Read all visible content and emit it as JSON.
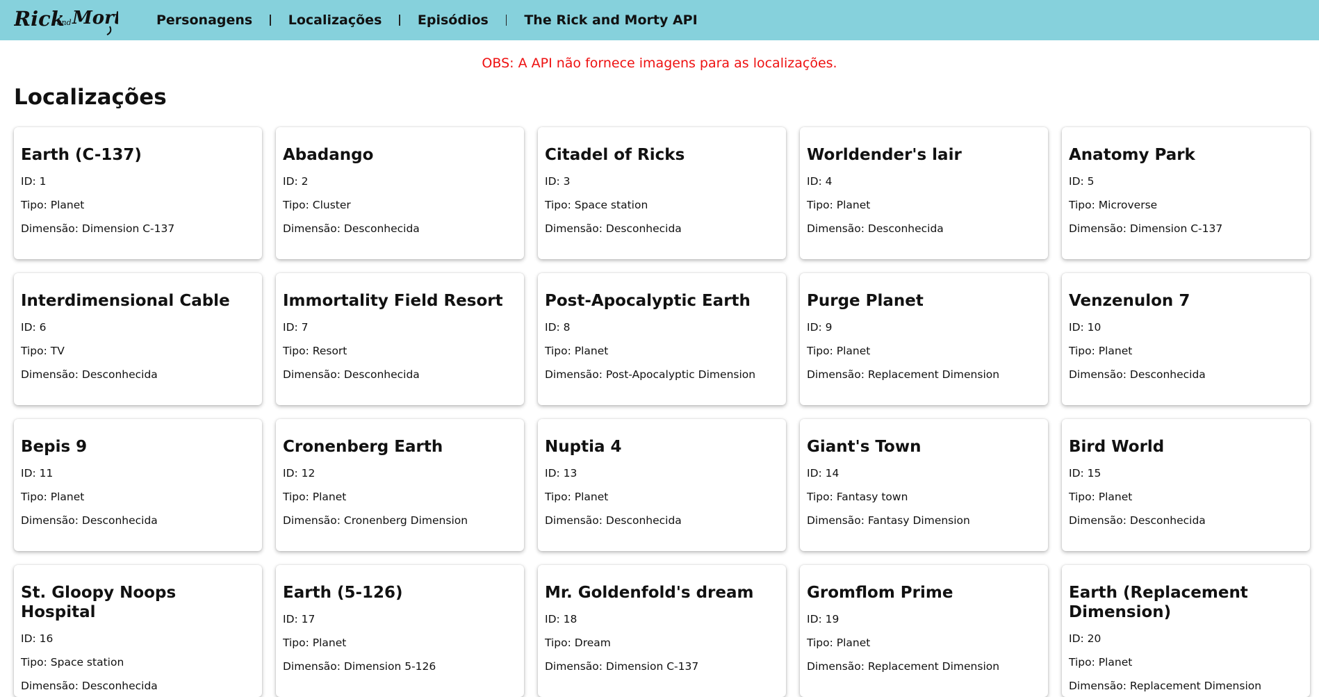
{
  "brand": {
    "logo_text_rick": "Rick",
    "logo_text_and": "and",
    "logo_text_morty": "Morty"
  },
  "nav": {
    "items": [
      {
        "label": "Personagens"
      },
      {
        "label": "Localizações"
      },
      {
        "label": "Episódios"
      },
      {
        "label": "The Rick and Morty API"
      }
    ]
  },
  "notice": "OBS: A API não fornece imagens para as localizações.",
  "page_title": "Localizações",
  "locations": [
    {
      "name": "Earth (C-137)",
      "id": "ID: 1",
      "type": "Tipo: Planet",
      "dimension": "Dimensão: Dimension C-137"
    },
    {
      "name": "Abadango",
      "id": "ID: 2",
      "type": "Tipo: Cluster",
      "dimension": "Dimensão: Desconhecida"
    },
    {
      "name": "Citadel of Ricks",
      "id": "ID: 3",
      "type": "Tipo: Space station",
      "dimension": "Dimensão: Desconhecida"
    },
    {
      "name": "Worldender's lair",
      "id": "ID: 4",
      "type": "Tipo: Planet",
      "dimension": "Dimensão: Desconhecida"
    },
    {
      "name": "Anatomy Park",
      "id": "ID: 5",
      "type": "Tipo: Microverse",
      "dimension": "Dimensão: Dimension C-137"
    },
    {
      "name": "Interdimensional Cable",
      "id": "ID: 6",
      "type": "Tipo: TV",
      "dimension": "Dimensão: Desconhecida"
    },
    {
      "name": "Immortality Field Resort",
      "id": "ID: 7",
      "type": "Tipo: Resort",
      "dimension": "Dimensão: Desconhecida"
    },
    {
      "name": "Post-Apocalyptic Earth",
      "id": "ID: 8",
      "type": "Tipo: Planet",
      "dimension": "Dimensão: Post-Apocalyptic Dimension"
    },
    {
      "name": "Purge Planet",
      "id": "ID: 9",
      "type": "Tipo: Planet",
      "dimension": "Dimensão: Replacement Dimension"
    },
    {
      "name": "Venzenulon 7",
      "id": "ID: 10",
      "type": "Tipo: Planet",
      "dimension": "Dimensão: Desconhecida"
    },
    {
      "name": "Bepis 9",
      "id": "ID: 11",
      "type": "Tipo: Planet",
      "dimension": "Dimensão: Desconhecida"
    },
    {
      "name": "Cronenberg Earth",
      "id": "ID: 12",
      "type": "Tipo: Planet",
      "dimension": "Dimensão: Cronenberg Dimension"
    },
    {
      "name": "Nuptia 4",
      "id": "ID: 13",
      "type": "Tipo: Planet",
      "dimension": "Dimensão: Desconhecida"
    },
    {
      "name": "Giant's Town",
      "id": "ID: 14",
      "type": "Tipo: Fantasy town",
      "dimension": "Dimensão: Fantasy Dimension"
    },
    {
      "name": "Bird World",
      "id": "ID: 15",
      "type": "Tipo: Planet",
      "dimension": "Dimensão: Desconhecida"
    },
    {
      "name": "St. Gloopy Noops Hospital",
      "id": "ID: 16",
      "type": "Tipo: Space station",
      "dimension": "Dimensão: Desconhecida"
    },
    {
      "name": "Earth (5-126)",
      "id": "ID: 17",
      "type": "Tipo: Planet",
      "dimension": "Dimensão: Dimension 5-126"
    },
    {
      "name": "Mr. Goldenfold's dream",
      "id": "ID: 18",
      "type": "Tipo: Dream",
      "dimension": "Dimensão: Dimension C-137"
    },
    {
      "name": "Gromflom Prime",
      "id": "ID: 19",
      "type": "Tipo: Planet",
      "dimension": "Dimensão: Replacement Dimension"
    },
    {
      "name": "Earth (Replacement Dimension)",
      "id": "ID: 20",
      "type": "Tipo: Planet",
      "dimension": "Dimensão: Replacement Dimension"
    }
  ],
  "colors": {
    "navbar_bg": "#86d1dc",
    "notice_text": "#ee1111",
    "text": "#111111"
  }
}
